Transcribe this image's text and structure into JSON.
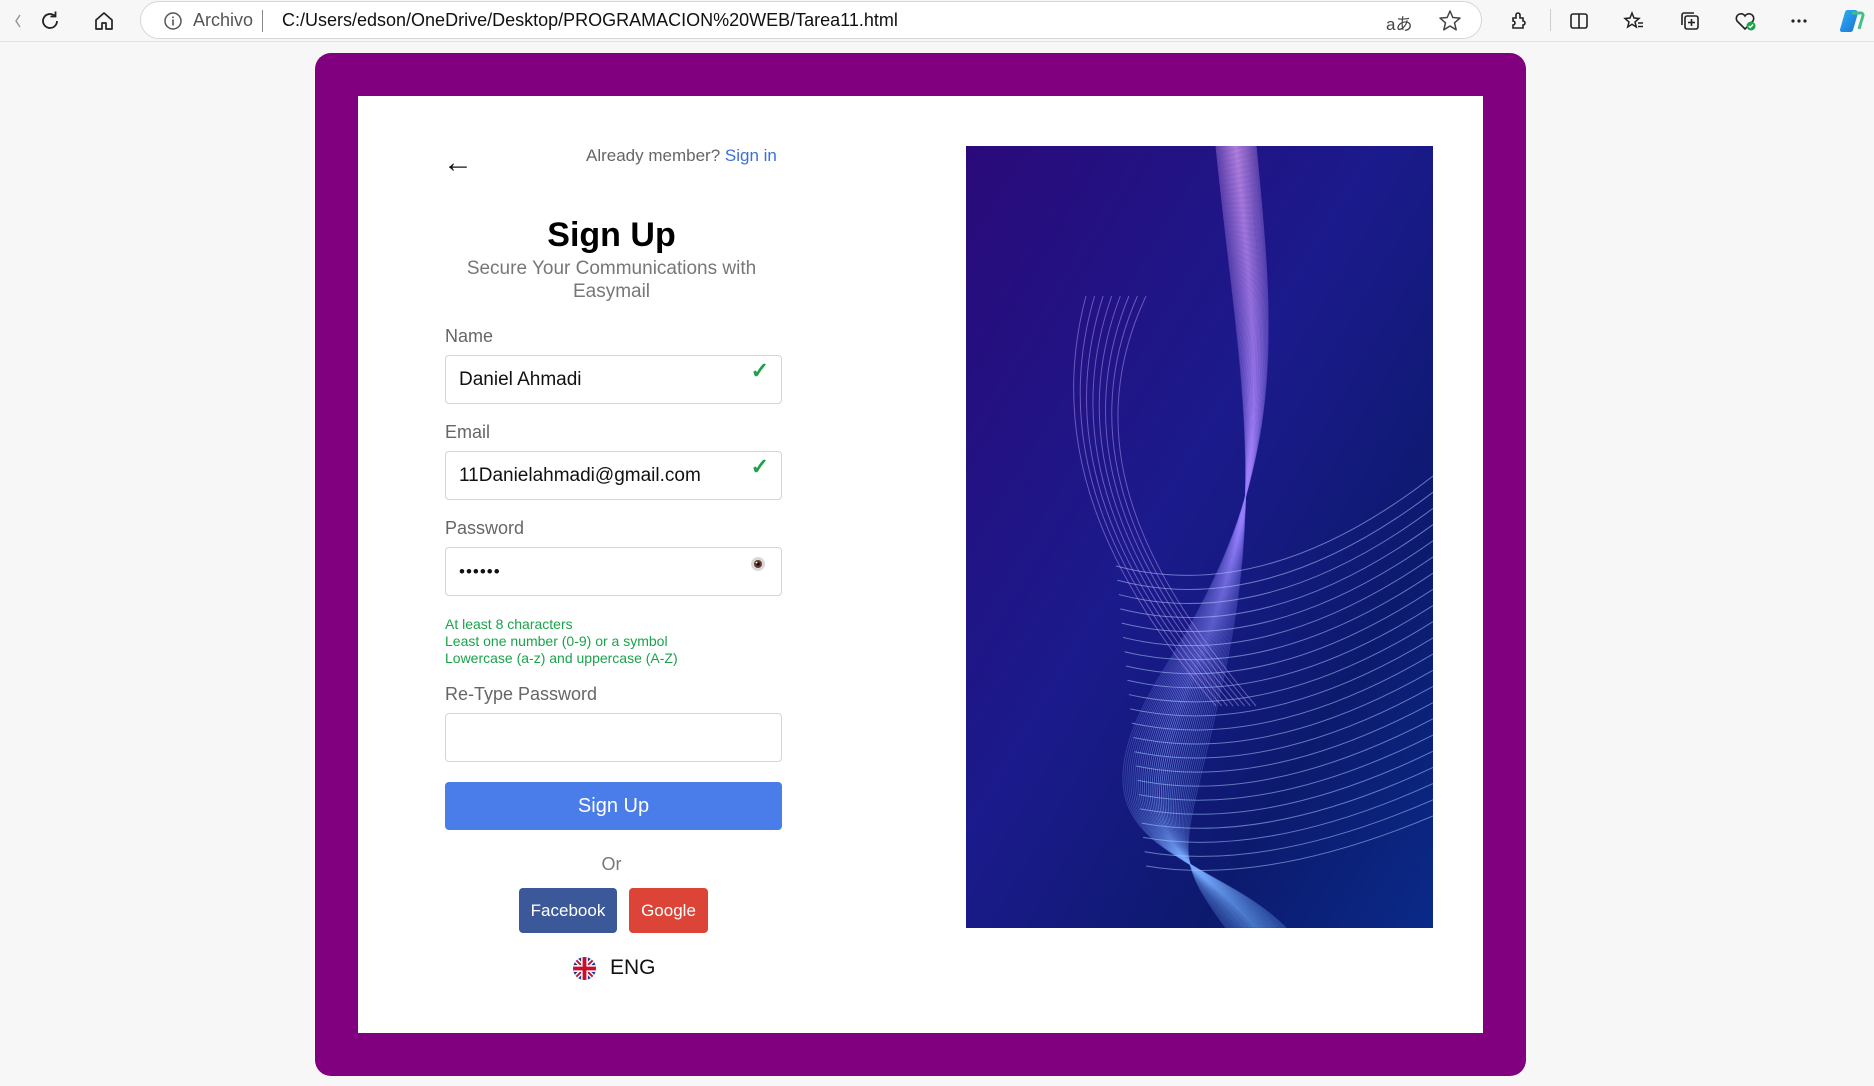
{
  "browser": {
    "scheme_label": "Archivo",
    "url": "C:/Users/edson/OneDrive/Desktop/PROGRAMACION%20WEB/Tarea11.html",
    "read_aloud": "aあ"
  },
  "colors": {
    "frame": "#800080",
    "primary": "#4a7de9",
    "facebook": "#3b5998",
    "google": "#dc4437",
    "valid": "#1aa34a"
  },
  "header": {
    "back": "←",
    "already_member": "Already member?",
    "sign_in": "Sign in"
  },
  "form": {
    "title": "Sign Up",
    "subtitle": "Secure Your Communications with Easymail",
    "name_label": "Name",
    "name_value": "Daniel Ahmadi",
    "email_label": "Email",
    "email_value": "11Danielahmadi@gmail.com",
    "password_label": "Password",
    "password_value": "••••••",
    "valid_mark": "✓",
    "rules": [
      "At least 8 characters",
      "Least one number (0-9) or a symbol",
      "Lowercase (a-z) and uppercase (A-Z)"
    ],
    "retype_label": "Re-Type Password",
    "retype_value": "",
    "submit": "Sign Up",
    "or": "Or",
    "facebook": "Facebook",
    "google": "Google",
    "language": "ENG"
  }
}
